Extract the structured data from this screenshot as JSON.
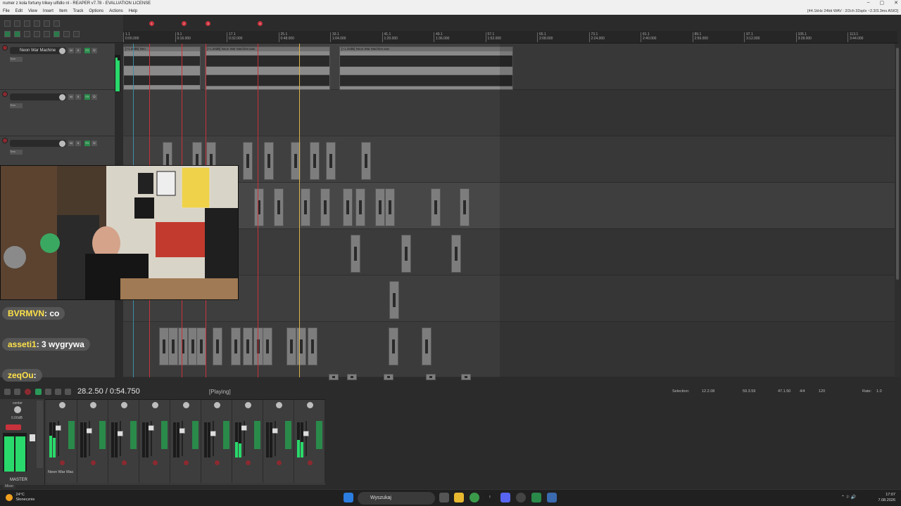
{
  "window": {
    "title": "numer z kola fortuny trikey ulfidlo nl - REAPER v7.78 - EVALUATION LICENSE",
    "audio_info": "[44.1kHz 24bit WAV : 2/2ch 32spls ~2.3/3.3ms ASIO]"
  },
  "menu": [
    "File",
    "Edit",
    "View",
    "Insert",
    "Item",
    "Track",
    "Options",
    "Actions",
    "Help"
  ],
  "ruler": {
    "ticks": [
      {
        "bar": "1.1",
        "time": "0:00.000"
      },
      {
        "bar": "9.1",
        "time": "0:16.000"
      },
      {
        "bar": "17.1",
        "time": "0:32.000"
      },
      {
        "bar": "25.1",
        "time": "0:48.000"
      },
      {
        "bar": "33.1",
        "time": "1:04.000"
      },
      {
        "bar": "41.1",
        "time": "1:20.000"
      },
      {
        "bar": "49.1",
        "time": "1:36.000"
      },
      {
        "bar": "57.1",
        "time": "1:52.000"
      },
      {
        "bar": "65.1",
        "time": "2:08.000"
      },
      {
        "bar": "73.1",
        "time": "2:24.000"
      },
      {
        "bar": "81.1",
        "time": "2:40.000"
      },
      {
        "bar": "89.1",
        "time": "2:56.000"
      },
      {
        "bar": "97.1",
        "time": "3:12.000"
      },
      {
        "bar": "105.1",
        "time": "3:28.000"
      },
      {
        "bar": "113.1",
        "time": "3:44.000"
      }
    ],
    "markers": [
      "1",
      "2",
      "3",
      "4"
    ]
  },
  "tracks": [
    {
      "name": "Neon War Machine",
      "env": "Trim"
    },
    {
      "name": "",
      "env": "Trim"
    },
    {
      "name": "",
      "env": "Trim"
    }
  ],
  "items": {
    "label_a": "[+1.20dB] Neo",
    "label_b": "[+1.20dB] Neon War Machine.wav",
    "label_c": "[+1.20dB] Neon War Machine.wav"
  },
  "chat": [
    {
      "user": "BVRMVN",
      "text": "co"
    },
    {
      "user": "asseti1",
      "text": "3 wygrywa"
    },
    {
      "user": "zeqOu",
      "text": ""
    }
  ],
  "transport": {
    "time": "28.2.50 / 0:54.750",
    "state": "[Playing]",
    "selection_label": "Selection:",
    "sel_start": "12.2.08",
    "sel_end": "59.3.59",
    "sel_len": "47.1.50",
    "time_sig": "4/4",
    "bpm": "120",
    "rate_label": "Rate:",
    "rate": "1.0"
  },
  "mixer": {
    "master_label": "MASTER",
    "master_vol": "0.00dB",
    "center_label": "center",
    "mixer_tab": "Mixer",
    "strip1_name": "Neon War Mac",
    "levels": [
      0.62,
      0.0,
      0.0,
      0.0,
      0.0,
      0.0,
      0.45,
      0.0,
      0.5
    ]
  },
  "taskbar": {
    "temp": "24°C",
    "weather": "Słonecznie",
    "search": "Wyszukaj",
    "time": "17:07",
    "date": "7.08.2026"
  }
}
